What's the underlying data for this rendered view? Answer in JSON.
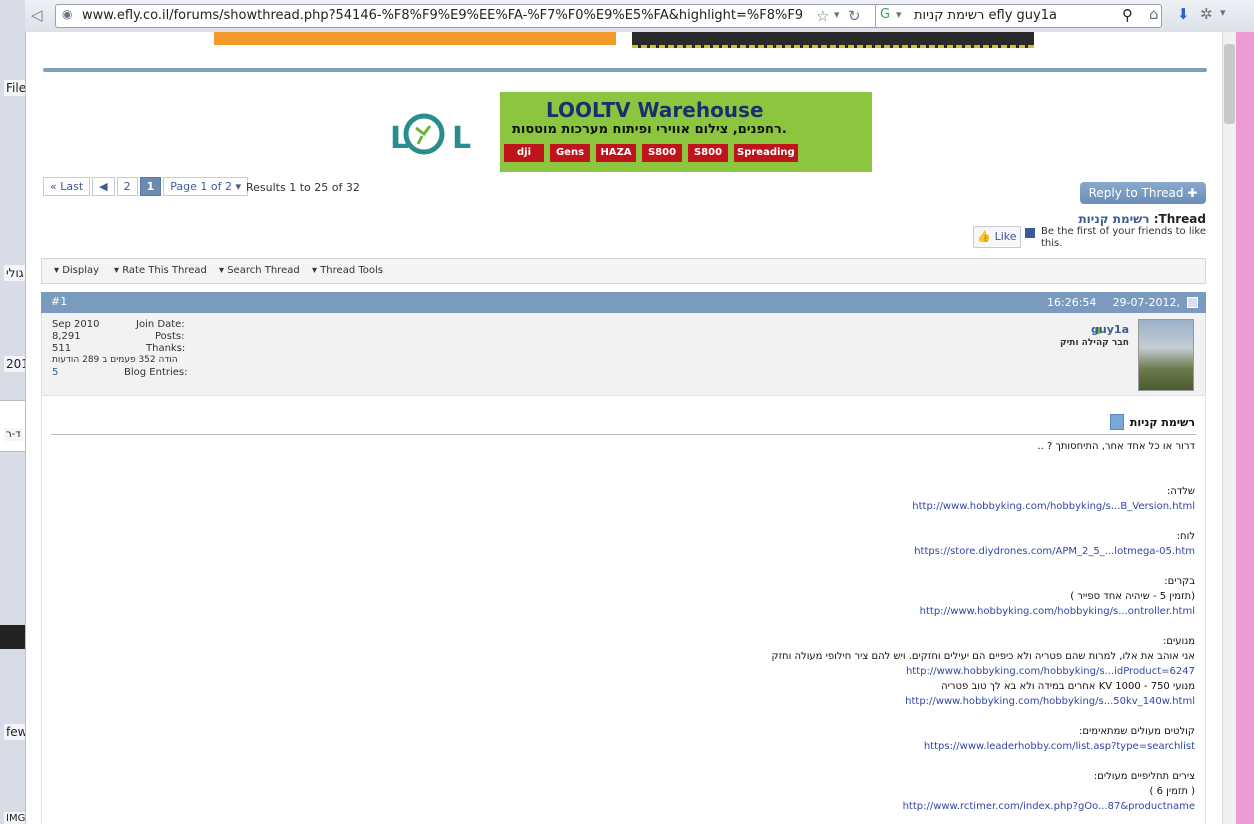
{
  "browser": {
    "url": "www.efly.co.il/forums/showthread.php?54146-%F8%F9%E9%EE%FA-%F7%F0%E9%E5%FA&highlight=%F8%F9",
    "search_query": "רשימת קניות efly guy1a"
  },
  "left_strip": {
    "items": [
      "File",
      "גולי",
      "201",
      "ד-ר",
      "few",
      "IMG"
    ]
  },
  "banner": {
    "title": "LOOLTV Warehouse",
    "subtitle": "רחפנים, צילום אווירי ופיתוח מערכות מוטסות.",
    "brands": [
      "dji",
      "Gens",
      "HAZA",
      "S800",
      "S800",
      "Spreading"
    ]
  },
  "pagination": {
    "last": "Last",
    "prev": "◀",
    "page2": "2",
    "page1": "1",
    "page_of": "Page 1 of 2",
    "results": "Results 1 to 25 of 32"
  },
  "thread": {
    "reply_button": "Reply to Thread",
    "label": "Thread:",
    "title": "רשימת קניות",
    "like_button": "Like",
    "like_text": "Be the first of your friends to like this."
  },
  "tools": {
    "display": "Display",
    "rate": "Rate This Thread",
    "search": "Search Thread",
    "thread_tools": "Thread Tools"
  },
  "post": {
    "number": "#1",
    "date": "29-07-2012,",
    "time": "16:26:54",
    "user": {
      "name": "guy1a",
      "title": "חבר קהילה ותיק"
    },
    "stats": {
      "join_date_label": "Join Date:",
      "join_date": "Sep 2010",
      "posts_label": "Posts:",
      "posts": "8,291",
      "thanks_label": "Thanks:",
      "thanks": "511",
      "thanked_line": "הודה 352 פעמים ב 289 הודעות",
      "blog_label": "Blog Entries:",
      "blog": "5"
    },
    "title": "רשימת קניות",
    "lines": [
      {
        "text": "דרור או כל אחד אחר, התיחסותך ? ..",
        "link": false
      },
      {
        "text": "שלדה:",
        "link": false
      },
      {
        "text": "http://www.hobbyking.com/hobbyking/s...B_Version.html",
        "link": true
      },
      {
        "text": "לוח:",
        "link": false
      },
      {
        "text": "https://store.diydrones.com/APM_2_5_...lotmega-05.htm",
        "link": true
      },
      {
        "text": "בקרים:",
        "link": false
      },
      {
        "text": "(תזמין 5 - שיהיה אחד ספייר )",
        "link": false
      },
      {
        "text": "http://www.hobbyking.com/hobbyking/s...ontroller.html",
        "link": true
      },
      {
        "text": "מנועים:",
        "link": false
      },
      {
        "text": "אני אוהב את אלו, למרות שהם פטריה ולא כיפיים הם יעילים וחזקים. ויש להם ציר חילופי מעולה וחזק",
        "link": false
      },
      {
        "text": "http://www.hobbyking.com/hobbyking/s...idProduct=6247",
        "link": true
      },
      {
        "text": "מנועי 750 - 1000 KV אחרים במידה ולא בא לך טוב פטריה",
        "link": false
      },
      {
        "text": "http://www.hobbyking.com/hobbyking/s...50kv_140w.html",
        "link": true
      },
      {
        "text": "קולטים מעולים שמתאימים:",
        "link": false
      },
      {
        "text": "https://www.leaderhobby.com/list.asp?type=searchlist",
        "link": true
      },
      {
        "text": "צירים תחליפיים מעולים:",
        "link": false
      },
      {
        "text": "( תזמין 6 )",
        "link": false
      },
      {
        "text": "http://www.rctimer.com/index.php?gOo...87&productname",
        "link": true
      }
    ]
  }
}
